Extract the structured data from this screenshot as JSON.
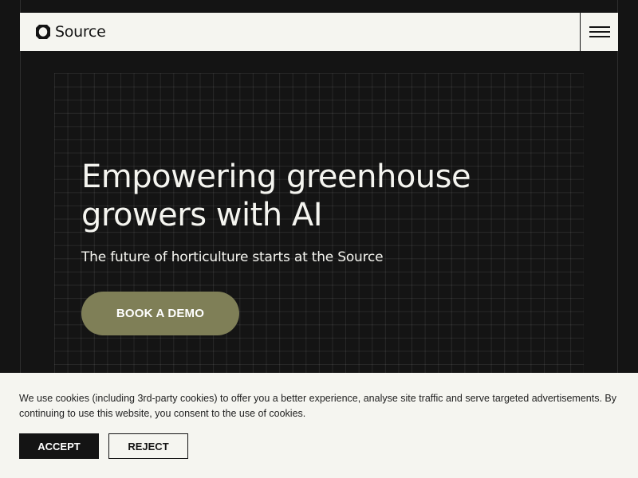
{
  "header": {
    "logo_text": "Source",
    "logo_icon": "source-logo-icon",
    "menu_icon": "hamburger-menu-icon"
  },
  "hero": {
    "title": "Empowering greenhouse growers with AI",
    "subtitle": "The future of horticulture starts at the Source",
    "cta_label": "BOOK A DEMO"
  },
  "cookie_banner": {
    "text": "We use cookies (including 3rd-party cookies) to offer you a better experience, analyse site traffic and serve targeted advertisements. By continuing to use this website, you consent to the use of cookies.",
    "accept_label": "ACCEPT",
    "reject_label": "REJECT"
  },
  "colors": {
    "background": "#141414",
    "header_bg": "#f5f5f0",
    "accent_olive": "#7f7f57",
    "text_light": "#f5f5f0",
    "text_dark": "#141414"
  }
}
